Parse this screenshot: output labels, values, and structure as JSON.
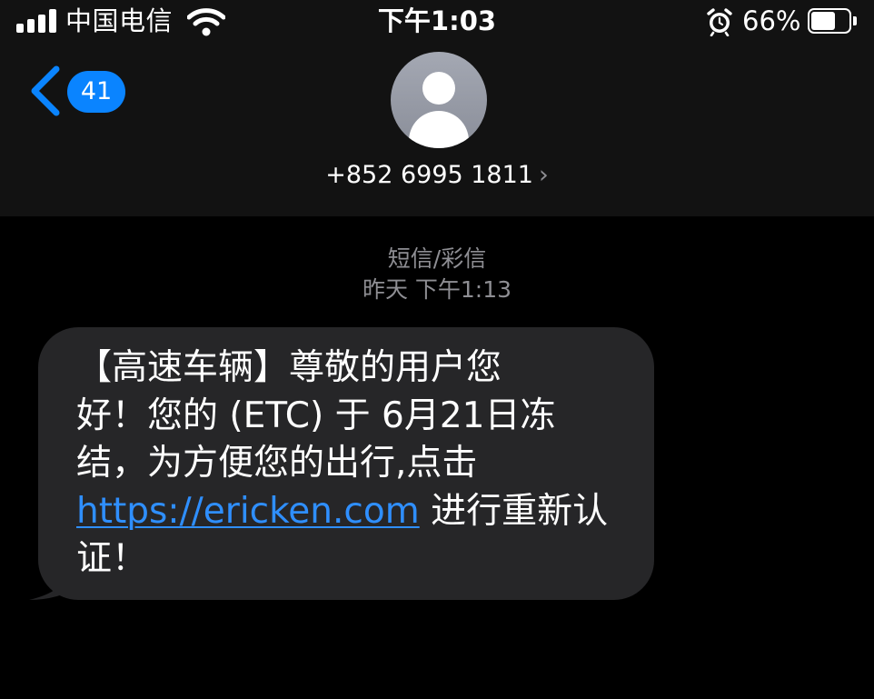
{
  "status_bar": {
    "carrier": "中国电信",
    "time": "下午1:03",
    "battery_percent": "66%",
    "battery_level": 0.66,
    "signal_bars": 4,
    "icons": [
      "signal-icon",
      "wifi-icon",
      "alarm-icon",
      "battery-icon"
    ]
  },
  "header": {
    "back_badge_count": "41",
    "contact_number": "+852 6995 1811",
    "chevron": "›",
    "icons": [
      "back-chevron-icon",
      "avatar-icon",
      "chevron-right-icon"
    ]
  },
  "conversation": {
    "message_type": "短信/彩信",
    "timestamp": "昨天 下午1:13",
    "message": {
      "line1": "【高速车辆】尊敬的用户您",
      "line2": "好！您的 (ETC) 于 6月21日冻",
      "line3": "结，为方便您的出行,点击",
      "link": "https://ericken.com",
      "line4_after_link": " 进行重新认",
      "line5": "证！"
    }
  },
  "colors": {
    "background": "#000000",
    "header_background": "#121212",
    "bubble": "#262628",
    "accent_blue": "#0a84ff",
    "link": "#2f8fff",
    "secondary_text": "#8e8e93"
  }
}
